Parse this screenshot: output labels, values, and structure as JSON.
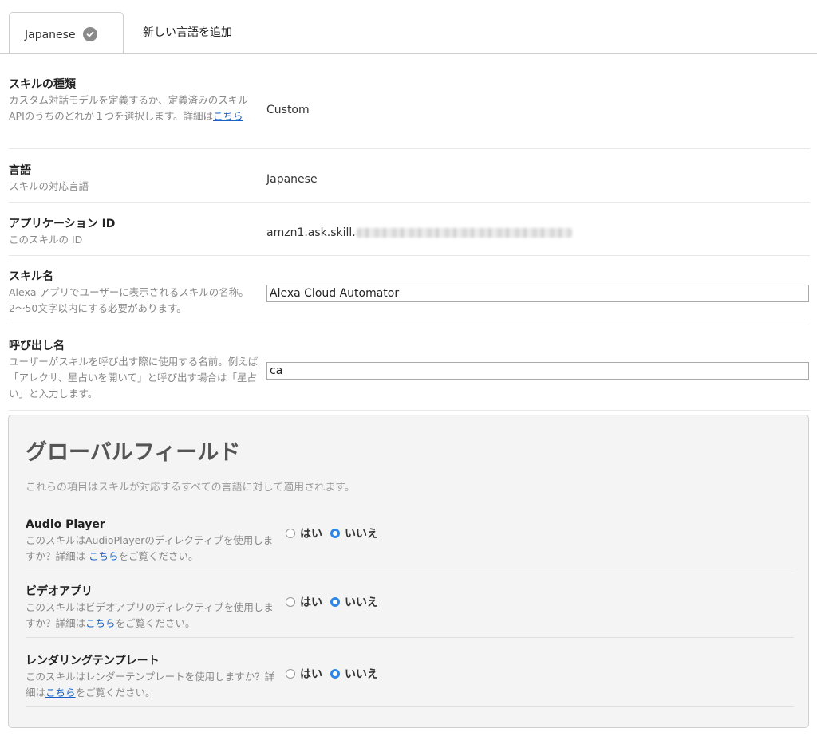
{
  "tabs": {
    "active_label": "Japanese",
    "add_label": "新しい言語を追加"
  },
  "skill_type": {
    "title": "スキルの種類",
    "desc": "カスタム対話モデルを定義するか、定義済みのスキルAPIのうちのどれか１つを選択します。詳細は",
    "link": "こちら",
    "value": "Custom"
  },
  "language": {
    "title": "言語",
    "desc": "スキルの対応言語",
    "value": "Japanese"
  },
  "app_id": {
    "title": "アプリケーション ID",
    "desc": "このスキルの ID",
    "value": "amzn1.ask.skill."
  },
  "skill_name": {
    "title": "スキル名",
    "desc": "Alexa アプリでユーザーに表示されるスキルの名称。2〜50文字以内にする必要があります。",
    "value": "Alexa Cloud Automator"
  },
  "invocation": {
    "title": "呼び出し名",
    "desc": "ユーザーがスキルを呼び出す際に使用する名前。例えば「アレクサ、星占いを開いて」と呼び出す場合は「星占い」と入力します。",
    "value": "ca"
  },
  "global": {
    "title": "グローバルフィールド",
    "desc": "これらの項目はスキルが対応するすべての言語に対して適用されます。",
    "yes": "はい",
    "no": "いいえ",
    "fields": [
      {
        "title": "Audio Player",
        "desc_a": "このスキルはAudioPlayerのディレクティブを使用しますか？詳細は ",
        "link": "こちら",
        "desc_b": "をご覧ください。",
        "selected": "no"
      },
      {
        "title": "ビデオアプリ",
        "desc_a": "このスキルはビデオアプリのディレクティブを使用しますか？詳細は",
        "link": "こちら",
        "desc_b": "をご覧ください。",
        "selected": "no"
      },
      {
        "title": "レンダリングテンプレート",
        "desc_a": "このスキルはレンダーテンプレートを使用しますか？詳細は",
        "link": "こちら",
        "desc_b": "をご覧ください。",
        "selected": "no"
      }
    ]
  }
}
